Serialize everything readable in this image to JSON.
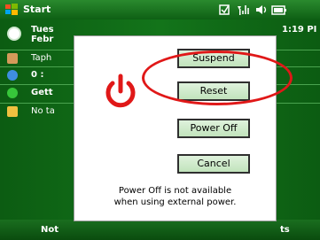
{
  "titlebar": {
    "app_title": "Start",
    "tray_icons": [
      "connectivity-icon",
      "signal-icon",
      "volume-icon",
      "battery-icon"
    ]
  },
  "today": {
    "date_line1": "Tues",
    "date_line2": "Febr",
    "time": "1:19 PI",
    "owner": "Taph",
    "messages": "0 :",
    "getting_started": "Gett",
    "tasks": "No ta"
  },
  "softkeys": {
    "left": "Not",
    "right": "ts"
  },
  "dialog": {
    "buttons": {
      "suspend": "Suspend",
      "reset": "Reset",
      "power_off": "Power Off",
      "cancel": "Cancel"
    },
    "note_line1": "Power Off is not available",
    "note_line2": "when using external power.",
    "icon": "power-icon",
    "accent_color": "#e01818"
  },
  "annotation": {
    "highlight_target": "reset-button",
    "color": "#e01818"
  }
}
